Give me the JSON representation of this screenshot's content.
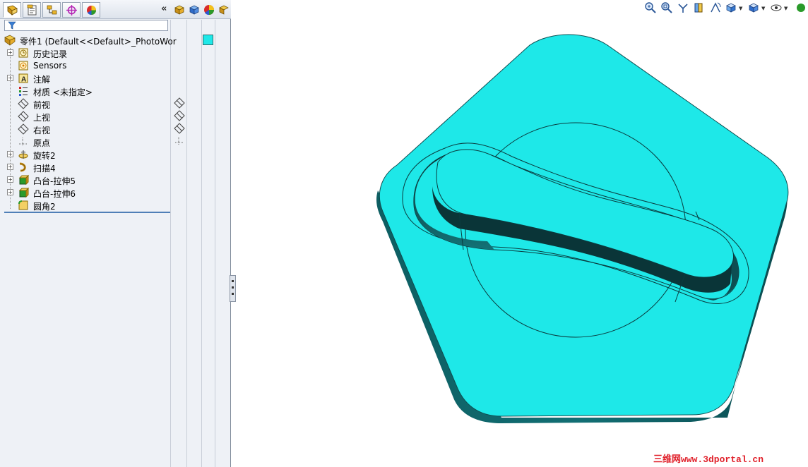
{
  "feature_tree": {
    "root": {
      "label": "零件1  (Default<<Default>_PhotoWor"
    },
    "items": [
      {
        "label": "历史记录",
        "icon": "history-icon",
        "expandable": true
      },
      {
        "label": "Sensors",
        "icon": "sensors-icon",
        "expandable": false
      },
      {
        "label": "注解",
        "icon": "annotations-icon",
        "expandable": true
      },
      {
        "label": "材质 <未指定>",
        "icon": "material-icon",
        "expandable": false
      },
      {
        "label": "前视",
        "icon": "plane-icon",
        "expandable": false
      },
      {
        "label": "上视",
        "icon": "plane-icon",
        "expandable": false
      },
      {
        "label": "右视",
        "icon": "plane-icon",
        "expandable": false
      },
      {
        "label": "原点",
        "icon": "origin-icon",
        "expandable": false
      },
      {
        "label": "旋转2",
        "icon": "revolve-icon",
        "expandable": true
      },
      {
        "label": "扫描4",
        "icon": "sweep-icon",
        "expandable": true
      },
      {
        "label": "凸台-拉伸5",
        "icon": "extrude-icon",
        "expandable": true
      },
      {
        "label": "凸台-拉伸6",
        "icon": "extrude-icon",
        "expandable": true
      },
      {
        "label": "圆角2",
        "icon": "fillet-icon",
        "expandable": false
      }
    ]
  },
  "panel": {
    "collapse_label": "«",
    "tabs": [
      "feature-manager-tab",
      "property-manager-tab",
      "configuration-manager-tab",
      "dimxpert-tab",
      "display-manager-tab"
    ]
  },
  "model": {
    "face_color": "#1ee8e8",
    "side_color": "#0f6f73",
    "dark_color": "#0a3b3e"
  },
  "watermark": "三维网www.3dportal.cn"
}
